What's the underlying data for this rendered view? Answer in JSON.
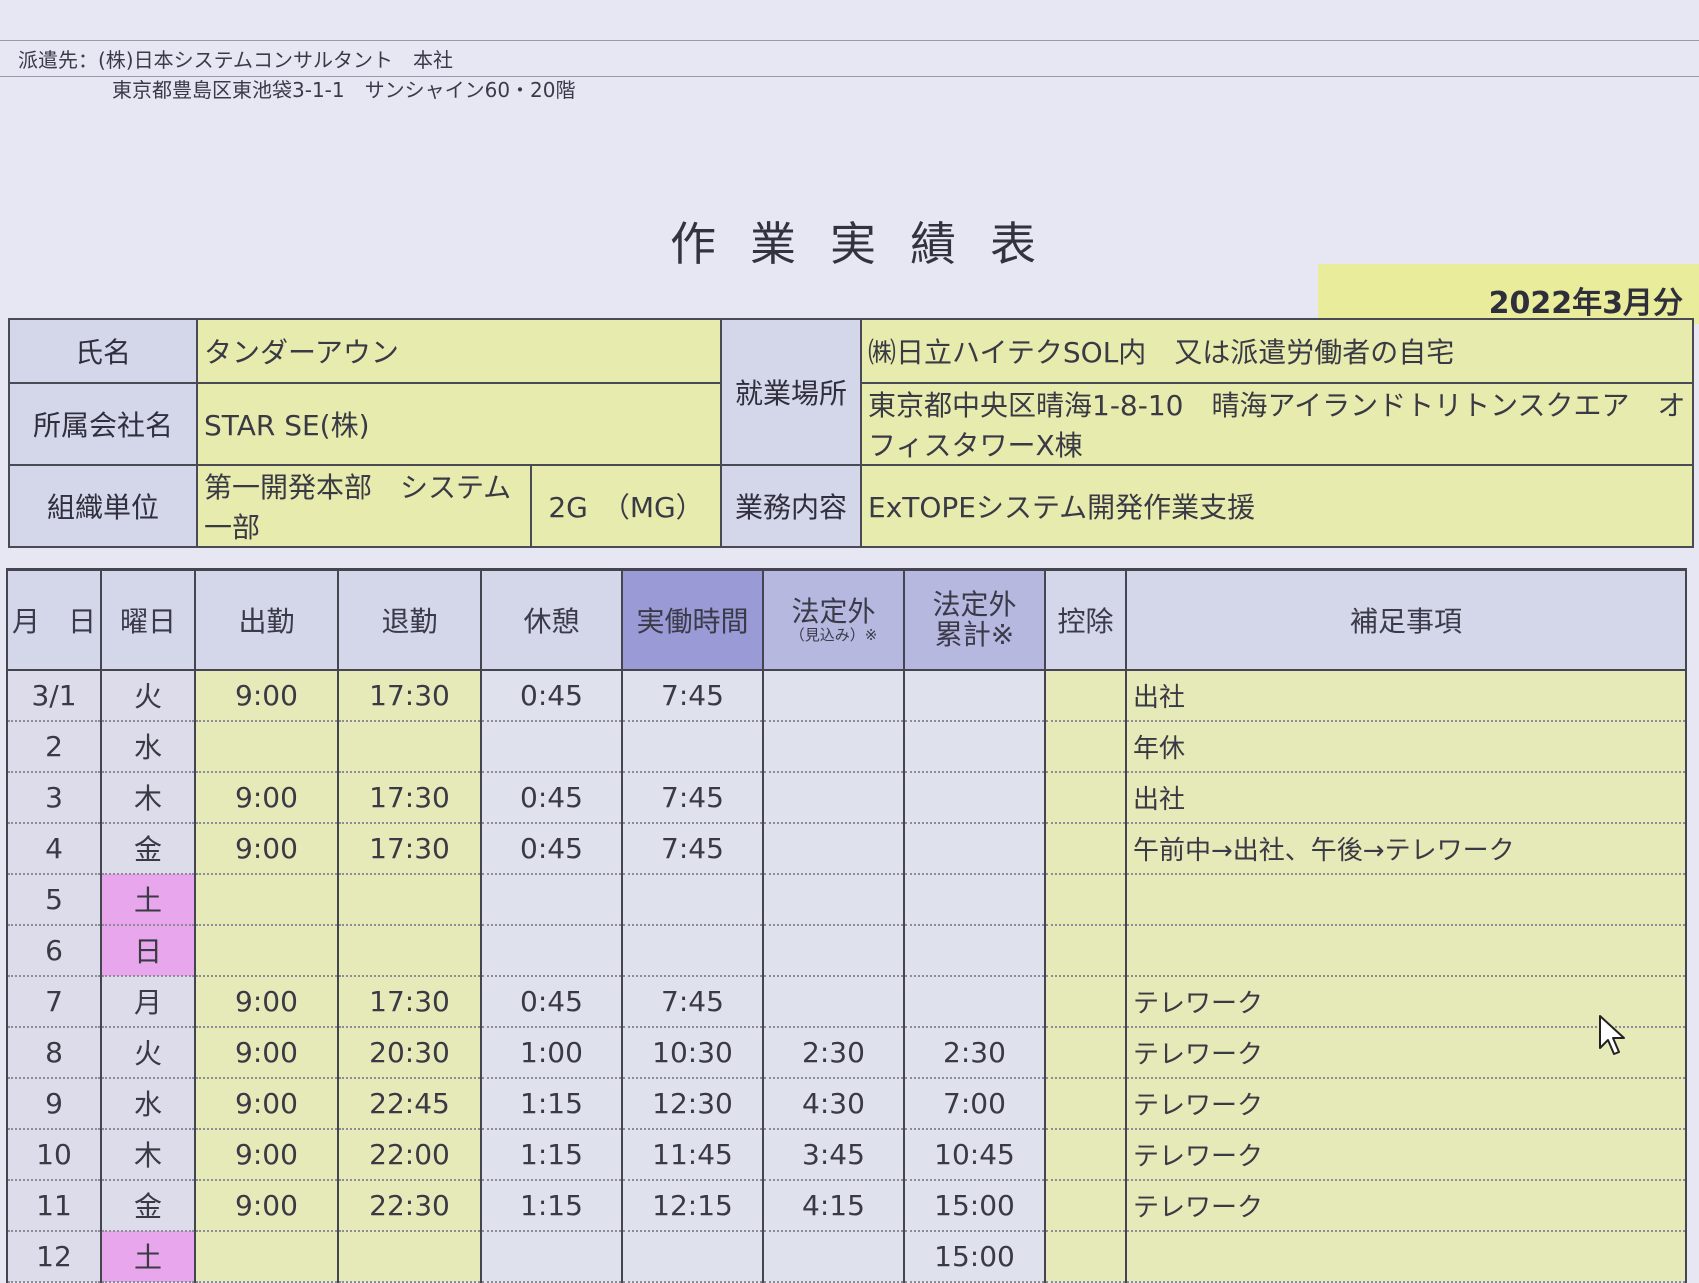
{
  "header": {
    "dispatch_line": "派遣先：(株)日本システムコンサルタント　本社",
    "address_line": "東京都豊島区東池袋3-1-1　サンシャイン60・20階"
  },
  "title": "作業実績表",
  "period": "2022年3月分",
  "info": {
    "name_label": "氏名",
    "name_value": "タンダーアウン",
    "company_label": "所属会社名",
    "company_value": "STAR SE(株)",
    "org_label": "組織単位",
    "org_value": "第一開発本部　システム一部",
    "org_group": "2G　（MG）",
    "workplace_label": "就業場所",
    "workplace_value": "㈱日立ハイテクSOL内　又は派遣労働者の自宅",
    "workplace_address": "東京都中央区晴海1-8-10　晴海アイランドトリトンスクエア　オフィスタワーX棟",
    "duty_label": "業務内容",
    "duty_value": "ExTOPEシステム開発作業支援"
  },
  "columns": {
    "date": "月　日",
    "weekday": "曜日",
    "start": "出勤",
    "end": "退勤",
    "break": "休憩",
    "actual": "実働時間",
    "overtime": "法定外",
    "overtime_note": "（見込み）※",
    "overtime_cum_1": "法定外",
    "overtime_cum_2": "累計※",
    "deduction": "控除",
    "notes": "補足事項"
  },
  "rows": [
    {
      "date": "3/1",
      "weekday": "火",
      "start": "9:00",
      "end": "17:30",
      "brk": "0:45",
      "actual": "7:45",
      "ot": "",
      "ot_cum": "",
      "deduct": "",
      "note": "出社"
    },
    {
      "date": "2",
      "weekday": "水",
      "start": "",
      "end": "",
      "brk": "",
      "actual": "",
      "ot": "",
      "ot_cum": "",
      "deduct": "",
      "note": "年休"
    },
    {
      "date": "3",
      "weekday": "木",
      "start": "9:00",
      "end": "17:30",
      "brk": "0:45",
      "actual": "7:45",
      "ot": "",
      "ot_cum": "",
      "deduct": "",
      "note": "出社"
    },
    {
      "date": "4",
      "weekday": "金",
      "start": "9:00",
      "end": "17:30",
      "brk": "0:45",
      "actual": "7:45",
      "ot": "",
      "ot_cum": "",
      "deduct": "",
      "note": "午前中→出社、午後→テレワーク"
    },
    {
      "date": "5",
      "weekday": "土",
      "start": "",
      "end": "",
      "brk": "",
      "actual": "",
      "ot": "",
      "ot_cum": "",
      "deduct": "",
      "note": ""
    },
    {
      "date": "6",
      "weekday": "日",
      "start": "",
      "end": "",
      "brk": "",
      "actual": "",
      "ot": "",
      "ot_cum": "",
      "deduct": "",
      "note": ""
    },
    {
      "date": "7",
      "weekday": "月",
      "start": "9:00",
      "end": "17:30",
      "brk": "0:45",
      "actual": "7:45",
      "ot": "",
      "ot_cum": "",
      "deduct": "",
      "note": "テレワーク"
    },
    {
      "date": "8",
      "weekday": "火",
      "start": "9:00",
      "end": "20:30",
      "brk": "1:00",
      "actual": "10:30",
      "ot": "2:30",
      "ot_cum": "2:30",
      "deduct": "",
      "note": "テレワーク"
    },
    {
      "date": "9",
      "weekday": "水",
      "start": "9:00",
      "end": "22:45",
      "brk": "1:15",
      "actual": "12:30",
      "ot": "4:30",
      "ot_cum": "7:00",
      "deduct": "",
      "note": "テレワーク"
    },
    {
      "date": "10",
      "weekday": "木",
      "start": "9:00",
      "end": "22:00",
      "brk": "1:15",
      "actual": "11:45",
      "ot": "3:45",
      "ot_cum": "10:45",
      "deduct": "",
      "note": "テレワーク"
    },
    {
      "date": "11",
      "weekday": "金",
      "start": "9:00",
      "end": "22:30",
      "brk": "1:15",
      "actual": "12:15",
      "ot": "4:15",
      "ot_cum": "15:00",
      "deduct": "",
      "note": "テレワーク"
    },
    {
      "date": "12",
      "weekday": "土",
      "start": "",
      "end": "",
      "brk": "",
      "actual": "",
      "ot": "",
      "ot_cum": "15:00",
      "deduct": "",
      "note": ""
    }
  ],
  "colors": {
    "weekend": "#e8a6ec",
    "input_cell": "#e6e9b8",
    "header": "#d4d6ea",
    "header_highlight": "#9a9bd6"
  },
  "icons": {
    "cursor": "mouse-pointer-icon"
  }
}
